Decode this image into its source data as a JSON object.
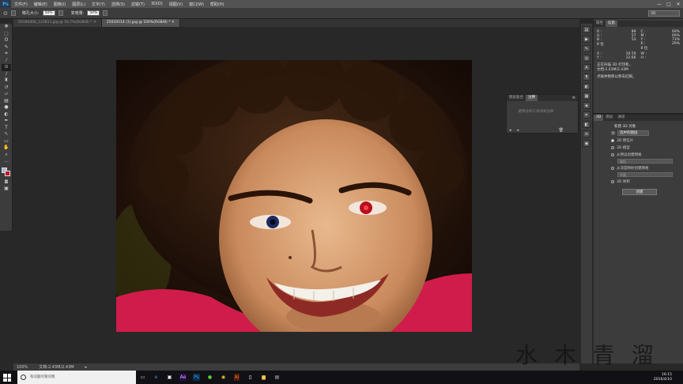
{
  "app": {
    "logo": "Ps",
    "menu": [
      "文件(F)",
      "编辑(E)",
      "图像(I)",
      "图层(L)",
      "文字(Y)",
      "选择(S)",
      "滤镜(T)",
      "3D(D)",
      "视图(V)",
      "窗口(W)",
      "帮助(H)"
    ],
    "window_controls": [
      "—",
      "□",
      "✕"
    ]
  },
  "options_bar": {
    "pupil_label": "瞳孔大小:",
    "pupil_value": "50%",
    "darken_label": "变暗量:",
    "darken_value": "50%"
  },
  "workspace": "3D",
  "tabs": [
    {
      "label": "20160404_123811.jpg @ 16.7%(RGB/8) *"
    },
    {
      "label": "25034514 (1).jpg @ 100%(RGB/8) *"
    }
  ],
  "status": {
    "zoom": "100%",
    "doc": "文档:2.43M/2.43M"
  },
  "panel_tabs_top": [
    "属性",
    "信息"
  ],
  "info": {
    "r": "89",
    "g": "57",
    "b": "53",
    "bit1": "8 位",
    "c": "69%",
    "m": "69%",
    "y": "73%",
    "k": "29%",
    "bit2": "8 位",
    "x": "10.59",
    "yv": "12.66",
    "w": "",
    "h": "",
    "line1": "正在扫描 3D 打印机...",
    "line2": "文档:2.43M/2.43M",
    "line3": "点按并拖移以移去红眼。"
  },
  "float_panel": {
    "tabs": [
      "图层复合",
      "注释"
    ],
    "hint": "使用注释工具添加注释"
  },
  "props": {
    "tabs": [
      "3D",
      "图层",
      "通道"
    ],
    "new_label": "新建 3D 对象",
    "source_label": "源:",
    "source_value": "选中的图层",
    "options": [
      "3D 明信片",
      "3D 模型",
      "从预设创建网格",
      "从深度映射创建网格",
      "3D 体积"
    ],
    "sub1": "锥形",
    "sub2": "平面",
    "create": "创建"
  },
  "taskbar": {
    "search_placeholder": "有问题尽管问我",
    "time": "16:15",
    "date": "2016/4/10"
  },
  "watermark": "水 木 青 溜"
}
